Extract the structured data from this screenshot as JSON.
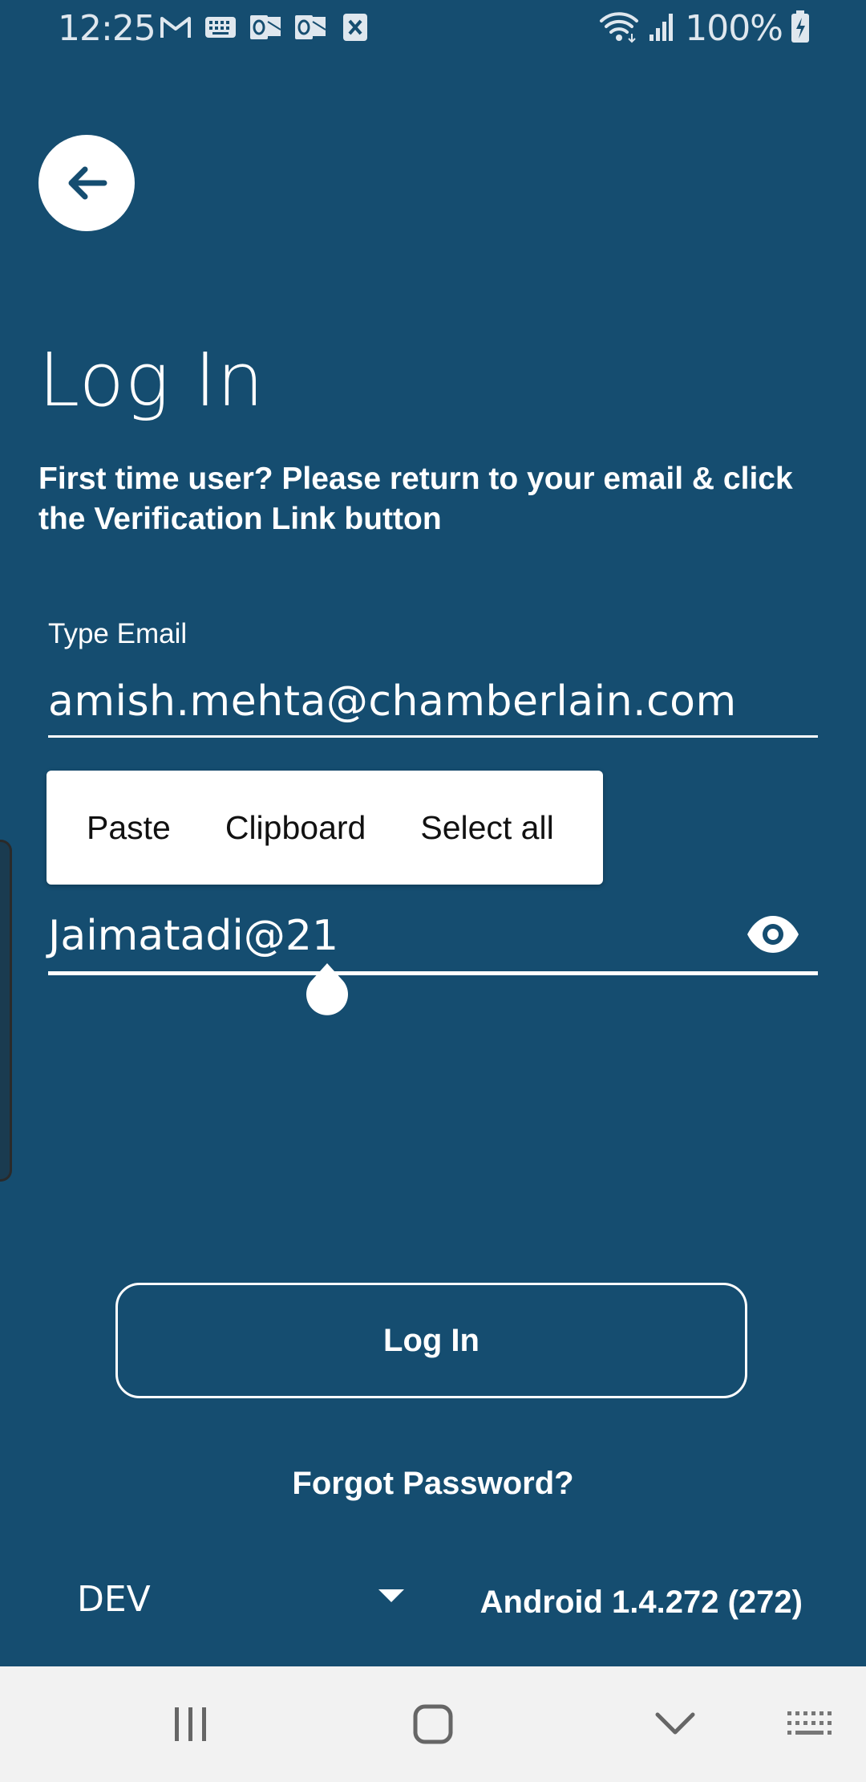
{
  "status_bar": {
    "time": "12:25",
    "battery": "100%",
    "left_icons": [
      "gmail-icon",
      "keyboard-icon",
      "outlook-icon",
      "outlook-icon",
      "excel-icon"
    ],
    "right_icons": [
      "wifi-icon",
      "signal-icon",
      "battery-charging-icon"
    ]
  },
  "header": {
    "back_icon": "arrow-left-icon"
  },
  "main": {
    "title": "Log In",
    "subtitle": "First time user? Please return to your email & click the Verification Link button",
    "email_label": "Type Email",
    "email_value": "amish.mehta@chamberlain.com",
    "password_value": "Jaimatadi@21",
    "password_toggle_icon": "eye-icon"
  },
  "context_menu": {
    "items": [
      "Paste",
      "Clipboard",
      "Select all"
    ]
  },
  "actions": {
    "login_label": "Log In",
    "forgot_label": "Forgot Password?"
  },
  "footer": {
    "environment": "DEV",
    "version": "Android 1.4.272 (272)"
  },
  "nav_bar": {
    "buttons": [
      "recent-apps-icon",
      "home-icon",
      "back-icon",
      "keyboard-toggle-icon"
    ]
  },
  "colors": {
    "background": "#154d70",
    "text": "#ffffff",
    "nav_bar": "#f2f2f2"
  }
}
